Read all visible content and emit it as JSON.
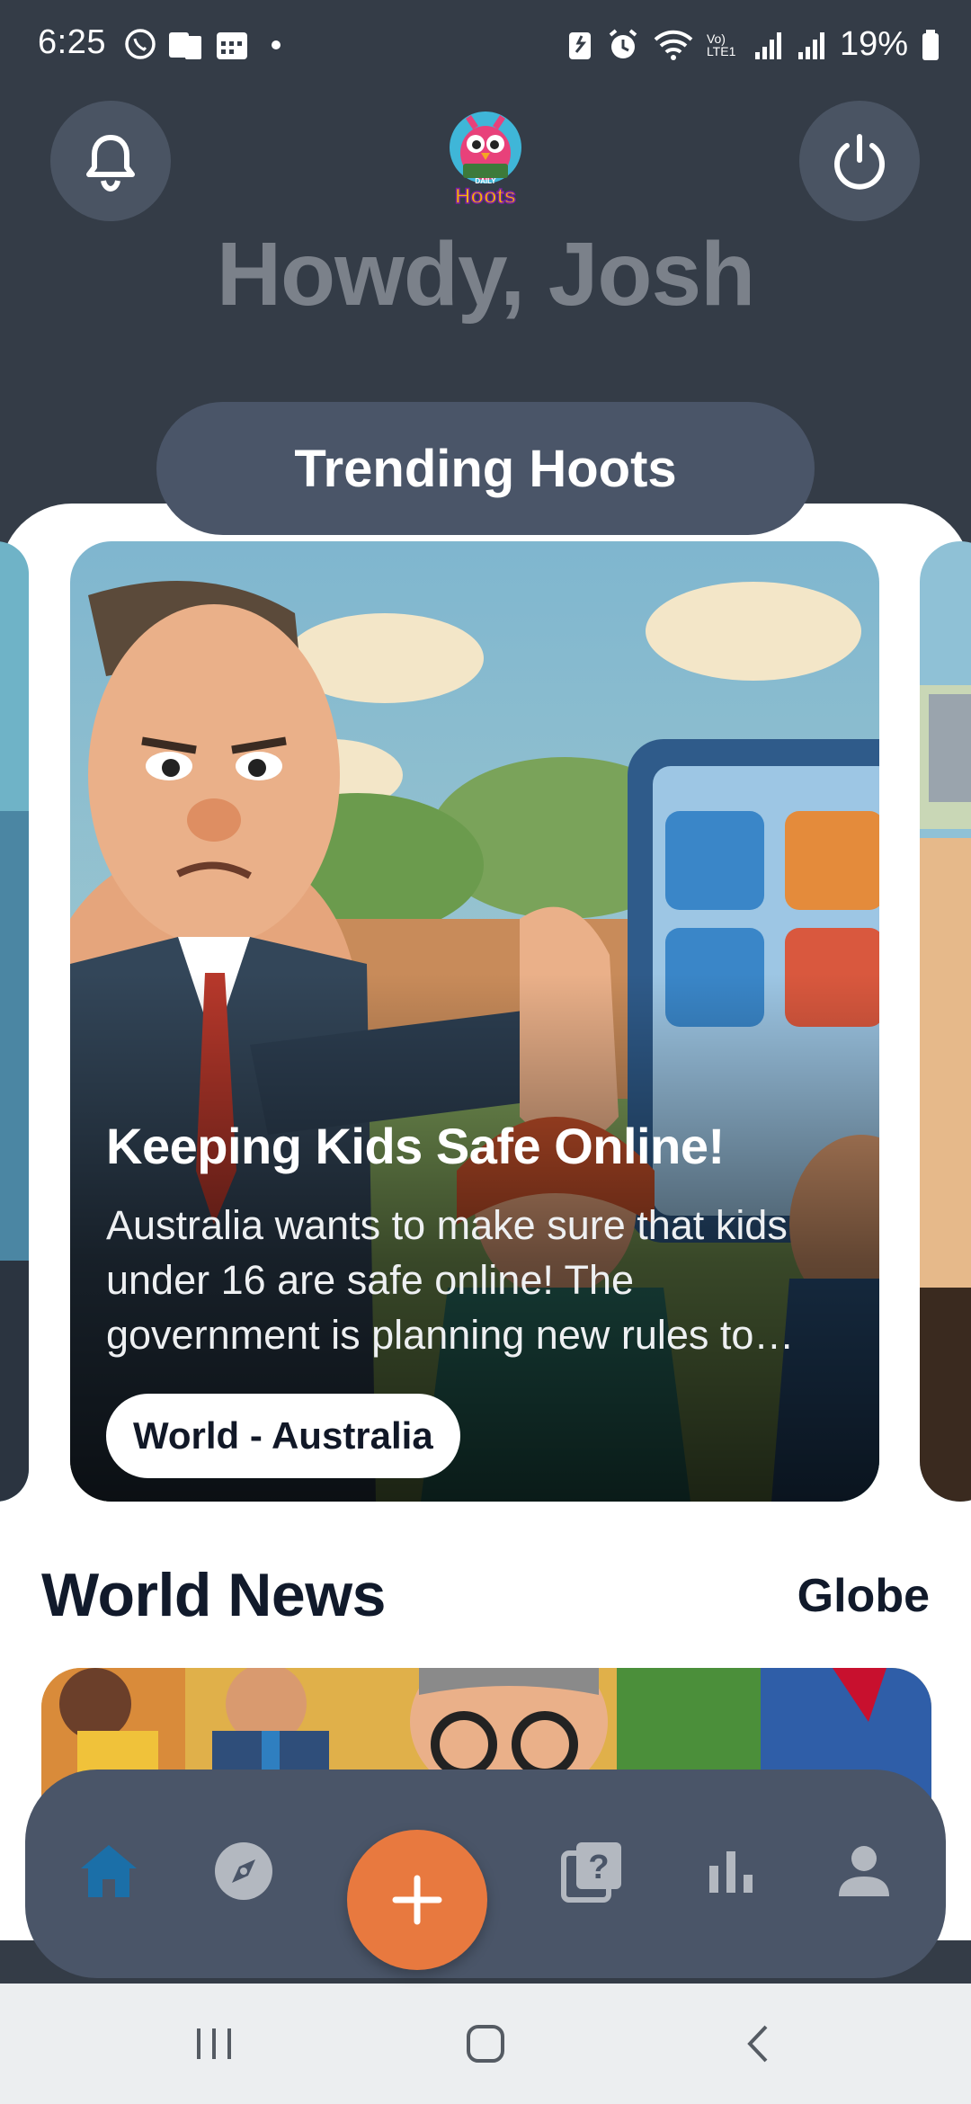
{
  "status_bar": {
    "time": "6:25",
    "battery": "19%",
    "network": "Vo) LTE1"
  },
  "header": {
    "logo_text_top": "DAILY",
    "logo_text": "Hoots",
    "greeting": "Howdy, Josh"
  },
  "trending": {
    "heading": "Trending Hoots",
    "card": {
      "title": "Keeping Kids Safe Online!",
      "description": "Australia wants to make sure that kids under 16 are safe online! The government is planning new rules to…",
      "tag": "World - Australia"
    }
  },
  "world_news": {
    "heading": "World News",
    "link": "Globe"
  },
  "bottom_nav": {
    "items": [
      {
        "icon": "home-icon",
        "active": true
      },
      {
        "icon": "compass-icon",
        "active": false
      },
      {
        "icon": "plus-icon",
        "active": false
      },
      {
        "icon": "quiz-icon",
        "active": false
      },
      {
        "icon": "stats-icon",
        "active": false
      },
      {
        "icon": "profile-icon",
        "active": false
      }
    ],
    "active_color": "#1b6fa8",
    "inactive_color": "#b3b8c0",
    "fab_color": "#e8793f"
  },
  "colors": {
    "background": "#343c47",
    "pill": "#4a5568",
    "title_text": "#111a2b"
  }
}
